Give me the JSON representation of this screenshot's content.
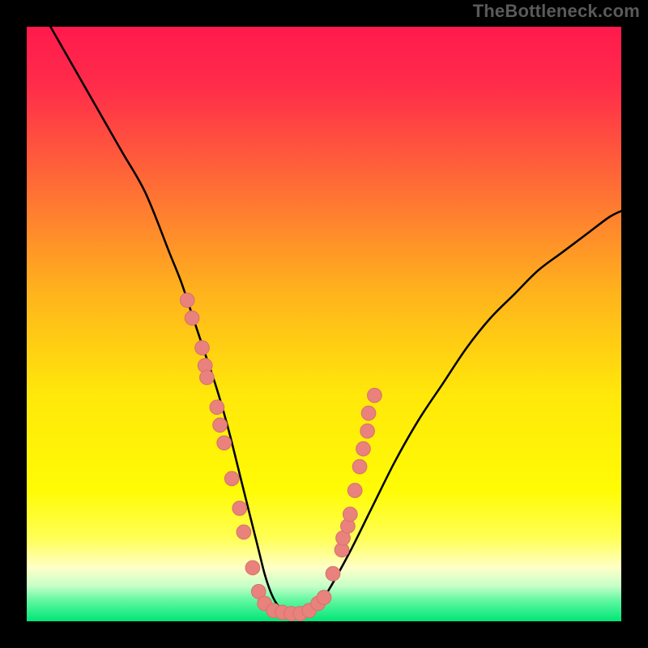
{
  "attribution": "TheBottleneck.com",
  "colors": {
    "frame": "#000000",
    "gradient_stops": [
      {
        "offset": 0.0,
        "color": "#ff1a4d"
      },
      {
        "offset": 0.1,
        "color": "#ff2c4a"
      },
      {
        "offset": 0.25,
        "color": "#ff6638"
      },
      {
        "offset": 0.45,
        "color": "#ffb41c"
      },
      {
        "offset": 0.62,
        "color": "#ffe80a"
      },
      {
        "offset": 0.78,
        "color": "#fffb05"
      },
      {
        "offset": 0.86,
        "color": "#ffff55"
      },
      {
        "offset": 0.91,
        "color": "#ffffc8"
      },
      {
        "offset": 0.94,
        "color": "#c8ffc8"
      },
      {
        "offset": 0.965,
        "color": "#60f7a0"
      },
      {
        "offset": 1.0,
        "color": "#00e676"
      }
    ],
    "curve": "#000000",
    "marker_fill": "#e9827d",
    "marker_stroke": "#d9726d"
  },
  "chart_data": {
    "type": "line",
    "title": "",
    "xlabel": "",
    "ylabel": "",
    "xlim": [
      0,
      100
    ],
    "ylim": [
      0,
      100
    ],
    "series": [
      {
        "name": "bottleneck-curve",
        "x": [
          4,
          8,
          12,
          16,
          20,
          24,
          26,
          28,
          30,
          32,
          34,
          36,
          37,
          38,
          39,
          40,
          41,
          42,
          43,
          44,
          46,
          48,
          50,
          54,
          58,
          62,
          66,
          70,
          74,
          78,
          82,
          86,
          90,
          94,
          98,
          100
        ],
        "y": [
          100,
          93,
          86,
          79,
          72,
          62,
          57,
          51,
          45,
          39,
          32,
          24,
          20,
          16,
          12,
          8,
          5,
          3,
          2,
          1.5,
          1,
          2,
          4,
          11,
          19,
          27,
          34,
          40,
          46,
          51,
          55,
          59,
          62,
          65,
          68,
          69
        ]
      }
    ],
    "markers": {
      "name": "sample-points",
      "points": [
        {
          "x": 27.0,
          "y": 54
        },
        {
          "x": 27.8,
          "y": 51
        },
        {
          "x": 29.5,
          "y": 46
        },
        {
          "x": 30.0,
          "y": 43
        },
        {
          "x": 30.3,
          "y": 41
        },
        {
          "x": 32.0,
          "y": 36
        },
        {
          "x": 32.5,
          "y": 33
        },
        {
          "x": 33.2,
          "y": 30
        },
        {
          "x": 34.5,
          "y": 24
        },
        {
          "x": 35.8,
          "y": 19
        },
        {
          "x": 36.5,
          "y": 15
        },
        {
          "x": 38.0,
          "y": 9
        },
        {
          "x": 39.0,
          "y": 5
        },
        {
          "x": 40.0,
          "y": 3
        },
        {
          "x": 41.5,
          "y": 1.8
        },
        {
          "x": 43.0,
          "y": 1.5
        },
        {
          "x": 44.5,
          "y": 1.3
        },
        {
          "x": 46.0,
          "y": 1.3
        },
        {
          "x": 47.5,
          "y": 1.8
        },
        {
          "x": 49.0,
          "y": 3
        },
        {
          "x": 50.0,
          "y": 4
        },
        {
          "x": 51.5,
          "y": 8
        },
        {
          "x": 53.0,
          "y": 12
        },
        {
          "x": 53.2,
          "y": 14
        },
        {
          "x": 54.0,
          "y": 16
        },
        {
          "x": 54.4,
          "y": 18
        },
        {
          "x": 55.2,
          "y": 22
        },
        {
          "x": 56.0,
          "y": 26
        },
        {
          "x": 56.6,
          "y": 29
        },
        {
          "x": 57.3,
          "y": 32
        },
        {
          "x": 57.5,
          "y": 35
        },
        {
          "x": 58.5,
          "y": 38
        }
      ]
    }
  }
}
